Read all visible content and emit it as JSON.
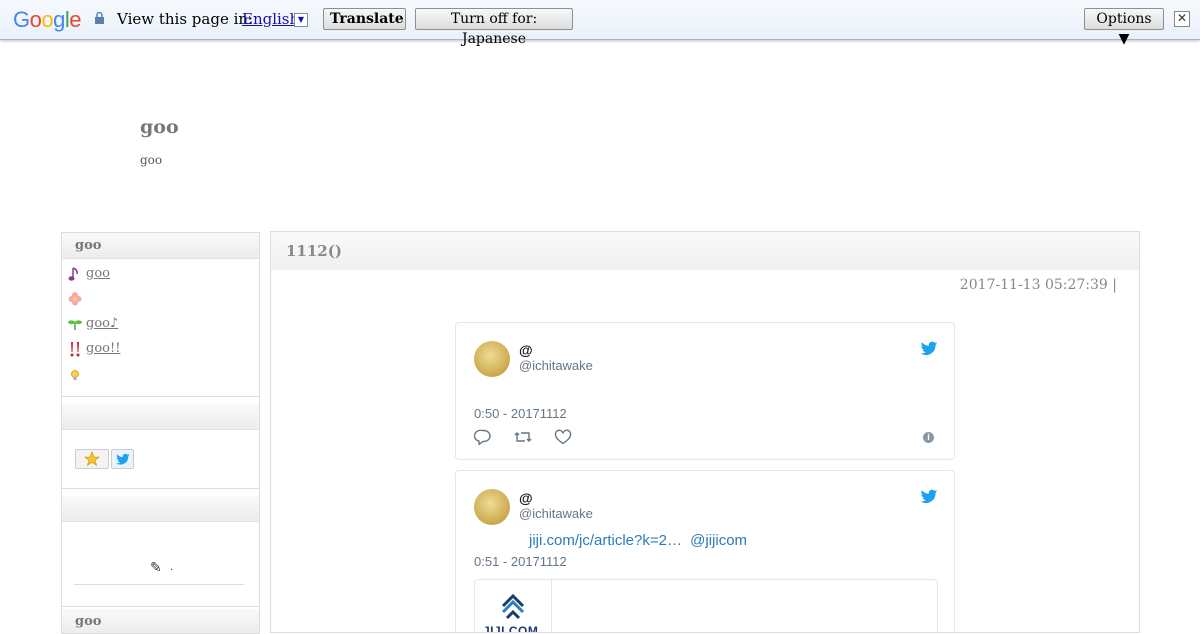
{
  "translate_bar": {
    "logo": "Google",
    "view_text": "View this page in:",
    "language": "English",
    "translate_label": "Translate",
    "turn_off_label": "Turn off for: Japanese",
    "options_label": "Options ▼",
    "close_label": "✕"
  },
  "blog": {
    "title": "goo",
    "description": "goo"
  },
  "sidebar": {
    "section1_title": "goo",
    "items": [
      {
        "icon": "music-note-icon",
        "label": "goo"
      },
      {
        "icon": "flower-icon",
        "label": ""
      },
      {
        "icon": "sprout-icon",
        "label": "goo♪ "
      },
      {
        "icon": "double-exclamation-icon",
        "label": "goo!! "
      },
      {
        "icon": "lightbulb-icon",
        "label": ""
      }
    ],
    "section2_title": "",
    "section3_title": "",
    "edit_text": ".",
    "section4_title": "goo"
  },
  "post": {
    "title": "1112()",
    "date": "2017-11-13 05:27:39 |"
  },
  "tweets": [
    {
      "name": "@",
      "handle": "@ichitawake",
      "time": "0:50 - 20171112"
    },
    {
      "name": "@",
      "handle": "@ichitawake",
      "link1": "jiji.com/jc/article?k=2…",
      "link2": "@jijicom",
      "time": "0:51 - 20171112",
      "card_logo": "JIJI.COM"
    }
  ],
  "colors": {
    "twitter_blue": "#1da1f2",
    "link_blue": "#2b7bb9",
    "google_link": "#1a0dab"
  }
}
